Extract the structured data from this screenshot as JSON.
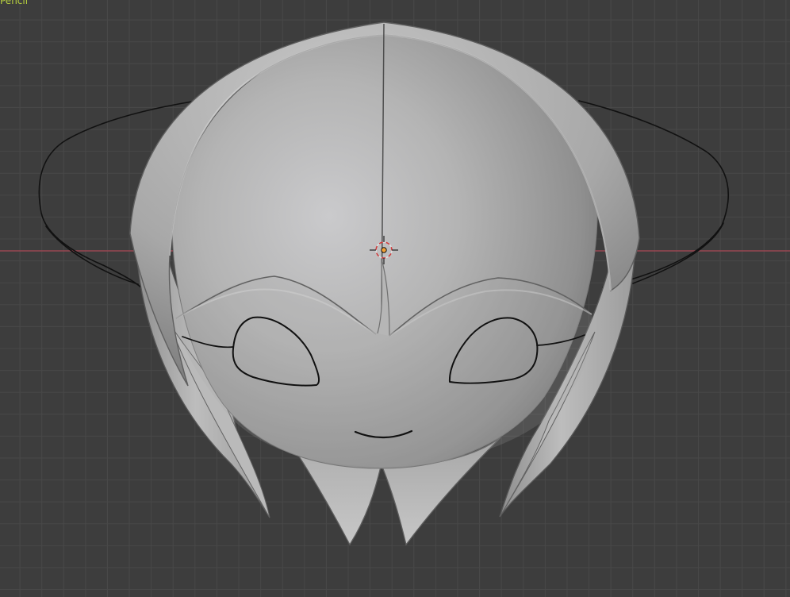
{
  "viewport": {
    "mode_label": "Pencil",
    "mode_label_color": "#b7cf3e",
    "grid_color": "#484848",
    "background_color": "#3d3d3d",
    "x_axis_color": "#9a4652",
    "model_base_color": "#bcbcbc",
    "stroke_color": "#111111"
  }
}
